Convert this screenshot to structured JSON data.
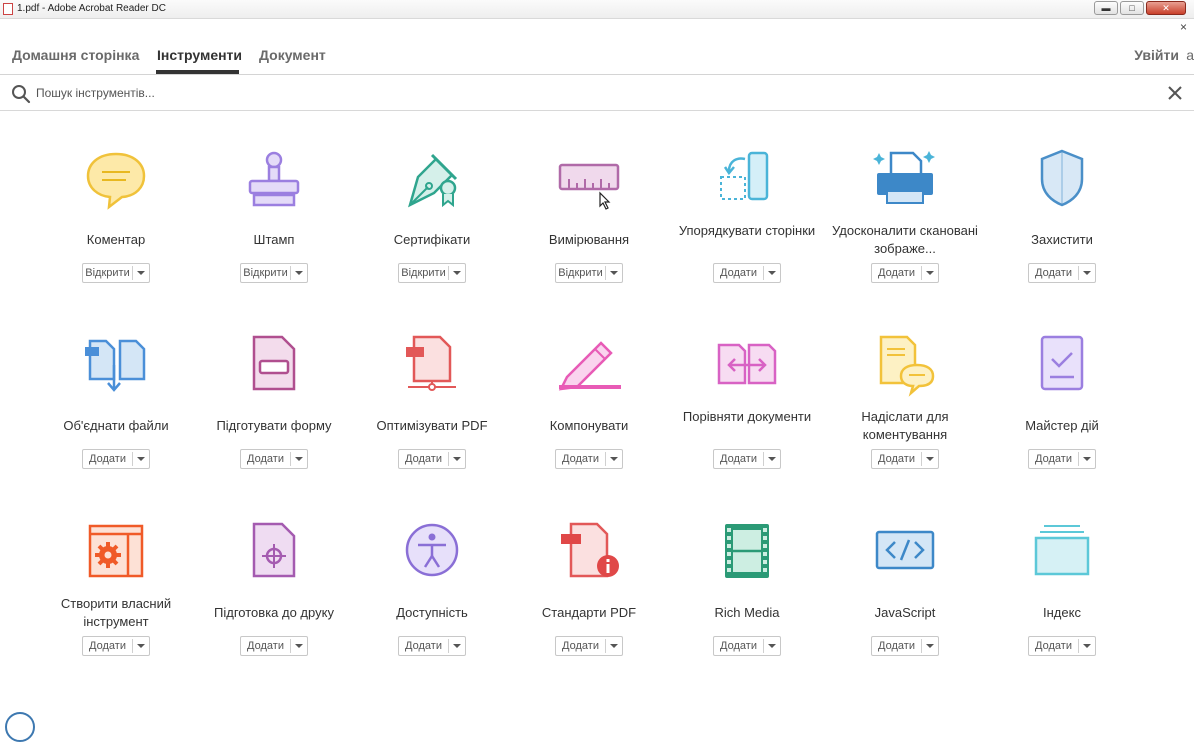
{
  "window": {
    "title": "1.pdf - Adobe Acrobat Reader DC",
    "minimize": "▬",
    "maximize": "□",
    "close": "✕",
    "app_close": "×"
  },
  "nav": {
    "tabs": [
      "Домашня сторінка",
      "Інструменти",
      "Документ"
    ],
    "active_tab": "Інструменти",
    "signin": "Увійти",
    "signin_extra": "a"
  },
  "search": {
    "placeholder": "Пошук інструментів..."
  },
  "tools": [
    {
      "label": "Коментар",
      "action": "Відкрити",
      "icon": "comment-icon",
      "color": "#f5c842"
    },
    {
      "label": "Штамп",
      "action": "Відкрити",
      "icon": "stamp-icon",
      "color": "#9b7fe0"
    },
    {
      "label": "Сертифікати",
      "action": "Відкрити",
      "icon": "certificate-icon",
      "color": "#2fa58e"
    },
    {
      "label": "Вимірювання",
      "action": "Відкрити",
      "icon": "ruler-icon",
      "color": "#b06aa8"
    },
    {
      "label": "Упорядкувати сторінки",
      "action": "Додати",
      "icon": "organize-pages-icon",
      "color": "#4ab4d8"
    },
    {
      "label": "Удосконалити скановані зображе...",
      "action": "Додати",
      "icon": "scan-icon",
      "color": "#3d88c8"
    },
    {
      "label": "Захистити",
      "action": "Додати",
      "icon": "shield-icon",
      "color": "#4a8fc8"
    },
    {
      "label": "Об'єднати файли",
      "action": "Додати",
      "icon": "combine-files-icon",
      "color": "#4a8fd8"
    },
    {
      "label": "Підготувати форму",
      "action": "Додати",
      "icon": "form-icon",
      "color": "#b04f8f"
    },
    {
      "label": "Оптимізувати PDF",
      "action": "Додати",
      "icon": "optimize-pdf-icon",
      "color": "#e25858"
    },
    {
      "label": "Компонувати",
      "action": "Додати",
      "icon": "compose-icon",
      "color": "#e85bb6"
    },
    {
      "label": "Порівняти документи",
      "action": "Додати",
      "icon": "compare-icon",
      "color": "#d862c4"
    },
    {
      "label": "Надіслати для коментування",
      "action": "Додати",
      "icon": "send-comment-icon",
      "color": "#f2c23a"
    },
    {
      "label": "Майстер дій",
      "action": "Додати",
      "icon": "action-wizard-icon",
      "color": "#9b7fe0"
    },
    {
      "label": "Створити власний інструмент",
      "action": "Додати",
      "icon": "custom-tool-icon",
      "color": "#f05a28"
    },
    {
      "label": "Підготовка до друку",
      "action": "Додати",
      "icon": "print-production-icon",
      "color": "#a45bb0"
    },
    {
      "label": "Доступність",
      "action": "Додати",
      "icon": "accessibility-icon",
      "color": "#8a6fd6"
    },
    {
      "label": "Стандарти PDF",
      "action": "Додати",
      "icon": "pdf-standards-icon",
      "color": "#e04848"
    },
    {
      "label": "Rich Media",
      "action": "Додати",
      "icon": "rich-media-icon",
      "color": "#2b9a76"
    },
    {
      "label": "JavaScript",
      "action": "Додати",
      "icon": "javascript-icon",
      "color": "#3d88c8"
    },
    {
      "label": "Індекс",
      "action": "Додати",
      "icon": "index-icon",
      "color": "#5cc8d8"
    }
  ]
}
